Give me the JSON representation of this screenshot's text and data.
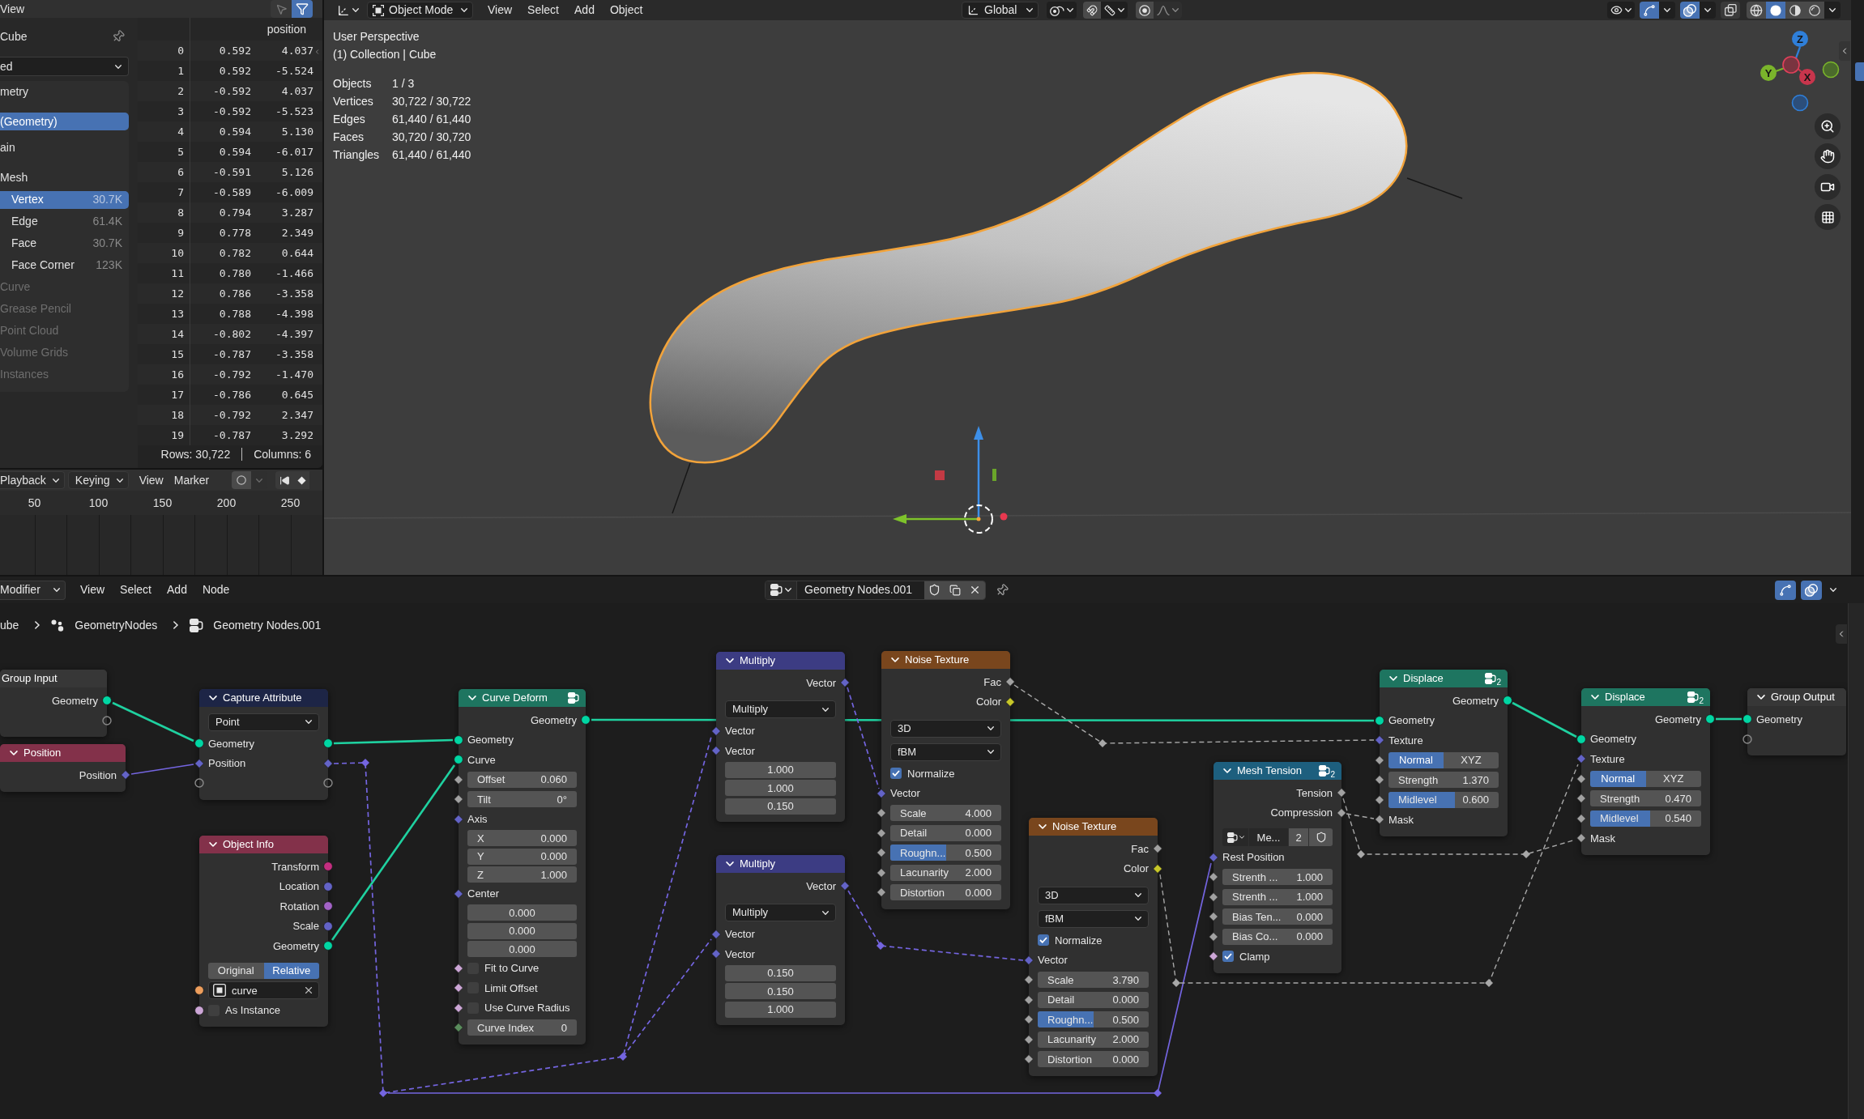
{
  "spreadsheet": {
    "header": {
      "menu": "View",
      "toggles": [
        {
          "kind": "selection",
          "on": false
        },
        {
          "kind": "filter",
          "on": true
        }
      ]
    },
    "sidebar": {
      "object": "Cube",
      "evaluation": "ed",
      "geometry_heading": "metry",
      "geometries": [
        {
          "label": "(Geometry)",
          "selected": true
        }
      ],
      "domain_heading": "ain",
      "domain_groups": [
        {
          "label": "Mesh",
          "disabled": false,
          "domains": [
            {
              "label": "Vertex",
              "count": "30.7K",
              "selected": true
            },
            {
              "label": "Edge",
              "count": "61.4K",
              "selected": false
            },
            {
              "label": "Face",
              "count": "30.7K",
              "selected": false
            },
            {
              "label": "Face Corner",
              "count": "123K",
              "selected": false
            }
          ]
        },
        {
          "label": "Curve",
          "disabled": true
        },
        {
          "label": "Grease Pencil",
          "disabled": true
        },
        {
          "label": "Point Cloud",
          "disabled": true
        },
        {
          "label": "Volume Grids",
          "disabled": true
        },
        {
          "label": "Instances",
          "disabled": true
        }
      ]
    },
    "table": {
      "column": "position",
      "rows": [
        {
          "index": "0",
          "values": [
            "0.592",
            "4.037"
          ]
        },
        {
          "index": "1",
          "values": [
            "0.592",
            "-5.524"
          ]
        },
        {
          "index": "2",
          "values": [
            "-0.592",
            "4.037"
          ]
        },
        {
          "index": "3",
          "values": [
            "-0.592",
            "-5.523"
          ]
        },
        {
          "index": "4",
          "values": [
            "0.594",
            "5.130"
          ]
        },
        {
          "index": "5",
          "values": [
            "0.594",
            "-6.017"
          ]
        },
        {
          "index": "6",
          "values": [
            "-0.591",
            "5.126"
          ]
        },
        {
          "index": "7",
          "values": [
            "-0.589",
            "-6.009"
          ]
        },
        {
          "index": "8",
          "values": [
            "0.794",
            "3.287"
          ]
        },
        {
          "index": "9",
          "values": [
            "0.778",
            "2.349"
          ]
        },
        {
          "index": "10",
          "values": [
            "0.782",
            "0.644"
          ]
        },
        {
          "index": "11",
          "values": [
            "0.780",
            "-1.466"
          ]
        },
        {
          "index": "12",
          "values": [
            "0.786",
            "-3.358"
          ]
        },
        {
          "index": "13",
          "values": [
            "0.788",
            "-4.398"
          ]
        },
        {
          "index": "14",
          "values": [
            "-0.802",
            "-4.397"
          ]
        },
        {
          "index": "15",
          "values": [
            "-0.787",
            "-3.358"
          ]
        },
        {
          "index": "16",
          "values": [
            "-0.792",
            "-1.470"
          ]
        },
        {
          "index": "17",
          "values": [
            "-0.786",
            "0.645"
          ]
        },
        {
          "index": "18",
          "values": [
            "-0.792",
            "2.347"
          ]
        },
        {
          "index": "19",
          "values": [
            "-0.787",
            "3.292"
          ]
        }
      ]
    },
    "footer": {
      "rows": "Rows: 30,722",
      "columns": "Columns: 6"
    }
  },
  "timeline": {
    "menus": [
      {
        "kind": "dropdown",
        "label": "Playback"
      },
      {
        "kind": "dropdown",
        "label": "Keying"
      },
      {
        "kind": "menu",
        "label": "View"
      },
      {
        "kind": "menu",
        "label": "Marker"
      }
    ],
    "auto_key": false,
    "frames": [
      "50",
      "100",
      "150",
      "200",
      "250"
    ]
  },
  "viewport": {
    "header": {
      "mode": "Object Mode",
      "menus": [
        "View",
        "Select",
        "Add",
        "Object"
      ],
      "orientation": "Global",
      "toggles": [
        {
          "kind": "gizmo",
          "on": true
        },
        {
          "kind": "overlay",
          "on": true
        },
        {
          "kind": "xray",
          "on": false
        }
      ],
      "shading": [
        {
          "kind": "wireframe",
          "selected": false
        },
        {
          "kind": "solid",
          "selected": true
        },
        {
          "kind": "material",
          "selected": false
        },
        {
          "kind": "rendered",
          "selected": false
        }
      ]
    },
    "overlay": {
      "view": "User Perspective",
      "context": "(1) Collection | Cube",
      "stats": [
        {
          "label": "Objects",
          "value": "1 / 3"
        },
        {
          "label": "Vertices",
          "value": "30,722 / 30,722"
        },
        {
          "label": "Edges",
          "value": "61,440 / 61,440"
        },
        {
          "label": "Faces",
          "value": "30,720 / 30,720"
        },
        {
          "label": "Triangles",
          "value": "61,440 / 61,440"
        }
      ]
    },
    "gizmo_axes": [
      {
        "label": "Z",
        "color": "#2f7fd9"
      },
      {
        "label": "Y",
        "color": "#7ab42b"
      },
      {
        "label": "X",
        "color": "#c8354c"
      }
    ]
  },
  "node_editor": {
    "header": {
      "editor": "Modifier",
      "menus": [
        "View",
        "Select",
        "Add",
        "Node"
      ],
      "tree": "Geometry Nodes.001",
      "toggles": [
        {
          "kind": "gizmo",
          "on": true
        },
        {
          "kind": "overlay",
          "on": true
        }
      ]
    },
    "breadcrumbs": [
      {
        "kind": "object",
        "label": "ube"
      },
      {
        "kind": "modifier",
        "label": "GeometryNodes"
      },
      {
        "kind": "node-tree",
        "label": "Geometry Nodes.001"
      }
    ],
    "nodes": [
      {
        "title": "Group Input",
        "color": "#373737",
        "group": false,
        "rows": [
          {
            "kind": "output",
            "label": "Geometry",
            "socket": {
              "kind": "circle",
              "color": "#00d6a3"
            }
          },
          {
            "kind": "output",
            "socket": {
              "kind": "ring"
            }
          }
        ]
      },
      {
        "title": "Position",
        "color": "#83314a",
        "expanded": true,
        "group": false,
        "rows": [
          {
            "kind": "output",
            "label": "Position",
            "socket": {
              "kind": "diamond",
              "color": "#6363c7"
            }
          }
        ]
      },
      {
        "title": "Capture Attribute",
        "color": "#1d2546",
        "expanded": true,
        "group": false,
        "rows": [
          {
            "kind": "dropdown",
            "value": "Point"
          },
          {
            "kind": "pass",
            "label": "Geometry",
            "socket": {
              "kind": "circle",
              "color": "#00d6a3"
            }
          },
          {
            "kind": "pass",
            "label": "Position",
            "socket": {
              "kind": "diamond",
              "color": "#6363c7"
            }
          },
          {
            "kind": "pass",
            "socket": {
              "kind": "ring"
            }
          }
        ]
      },
      {
        "title": "Object Info",
        "color": "#83314a",
        "expanded": true,
        "group": false,
        "rows": [
          {
            "kind": "output",
            "label": "Transform",
            "socket": {
              "kind": "circle",
              "color": "#c42e80"
            }
          },
          {
            "kind": "output",
            "label": "Location",
            "socket": {
              "kind": "circle",
              "color": "#6363c7"
            }
          },
          {
            "kind": "output",
            "label": "Rotation",
            "socket": {
              "kind": "circle",
              "color": "#a363c7"
            }
          },
          {
            "kind": "output",
            "label": "Scale",
            "socket": {
              "kind": "circle",
              "color": "#6363c7"
            }
          },
          {
            "kind": "output",
            "label": "Geometry",
            "socket": {
              "kind": "circle",
              "color": "#00d6a3"
            }
          },
          {
            "kind": "segmented",
            "options": [
              {
                "label": "Original",
                "selected": false
              },
              {
                "label": "Relative",
                "selected": true
              }
            ]
          },
          {
            "kind": "object",
            "value": "curve",
            "socket": {
              "kind": "circle",
              "color": "#ed9e5c"
            }
          },
          {
            "kind": "checkbox",
            "label": "As Instance",
            "checked": false,
            "socket": {
              "kind": "circle",
              "color": "#cca6d6"
            }
          }
        ]
      },
      {
        "title": "Curve Deform",
        "color": "#1e7560",
        "expanded": true,
        "group": true,
        "rows": [
          {
            "kind": "output",
            "label": "Geometry",
            "socket": {
              "kind": "circle",
              "color": "#00d6a3"
            }
          },
          {
            "kind": "input",
            "label": "Geometry",
            "socket": {
              "kind": "circle",
              "color": "#00d6a3"
            }
          },
          {
            "kind": "input",
            "label": "Curve",
            "socket": {
              "kind": "circle",
              "color": "#00d6a3"
            }
          },
          {
            "kind": "field",
            "label": "Offset",
            "value": "0.060",
            "socket": {
              "kind": "diamond",
              "color": "#a1a1a1"
            }
          },
          {
            "kind": "field",
            "label": "Tilt",
            "value": "0°",
            "socket": {
              "kind": "diamond",
              "color": "#a1a1a1"
            }
          },
          {
            "kind": "input",
            "label": "Axis",
            "socket": {
              "kind": "diamond",
              "color": "#6363c7"
            }
          },
          {
            "kind": "component",
            "label": "X",
            "value": "0.000"
          },
          {
            "kind": "component",
            "label": "Y",
            "value": "0.000"
          },
          {
            "kind": "component",
            "label": "Z",
            "value": "1.000"
          },
          {
            "kind": "input",
            "label": "Center",
            "socket": {
              "kind": "diamond",
              "color": "#6363c7"
            }
          },
          {
            "kind": "component",
            "value": "0.000"
          },
          {
            "kind": "component",
            "value": "0.000"
          },
          {
            "kind": "component",
            "value": "0.000"
          },
          {
            "kind": "checkbox",
            "label": "Fit to Curve",
            "checked": false,
            "socket": {
              "kind": "diamond",
              "color": "#cca6d6"
            }
          },
          {
            "kind": "checkbox",
            "label": "Limit Offset",
            "checked": false,
            "socket": {
              "kind": "diamond",
              "color": "#cca6d6"
            }
          },
          {
            "kind": "checkbox",
            "label": "Use Curve Radius",
            "checked": false,
            "socket": {
              "kind": "diamond",
              "color": "#cca6d6"
            }
          },
          {
            "kind": "field",
            "label": "Curve Index",
            "value": "0",
            "socket": {
              "kind": "diamond",
              "color": "#598c5c"
            }
          }
        ]
      },
      {
        "title": "Multiply",
        "color": "#3c3c83",
        "expanded": true,
        "group": false,
        "rows": [
          {
            "kind": "output",
            "label": "Vector",
            "socket": {
              "kind": "diamond",
              "color": "#6363c7"
            }
          },
          {
            "kind": "dropdown",
            "value": "Multiply"
          },
          {
            "kind": "input",
            "label": "Vector",
            "socket": {
              "kind": "diamond",
              "color": "#6363c7"
            }
          },
          {
            "kind": "input",
            "label": "Vector",
            "socket": {
              "kind": "diamond",
              "color": "#6363c7"
            }
          },
          {
            "kind": "component",
            "value": "1.000"
          },
          {
            "kind": "component",
            "value": "1.000"
          },
          {
            "kind": "component",
            "value": "0.150"
          }
        ]
      },
      {
        "title": "Multiply",
        "color": "#3c3c83",
        "expanded": true,
        "group": false,
        "rows": [
          {
            "kind": "output",
            "label": "Vector",
            "socket": {
              "kind": "diamond",
              "color": "#6363c7"
            }
          },
          {
            "kind": "dropdown",
            "value": "Multiply"
          },
          {
            "kind": "input",
            "label": "Vector",
            "socket": {
              "kind": "diamond",
              "color": "#6363c7"
            }
          },
          {
            "kind": "input",
            "label": "Vector",
            "socket": {
              "kind": "diamond",
              "color": "#6363c7"
            }
          },
          {
            "kind": "component",
            "value": "0.150"
          },
          {
            "kind": "component",
            "value": "0.150"
          },
          {
            "kind": "component",
            "value": "1.000"
          }
        ]
      },
      {
        "title": "Noise Texture",
        "color": "#79461d",
        "expanded": true,
        "group": false,
        "rows": [
          {
            "kind": "output",
            "label": "Fac",
            "socket": {
              "kind": "diamond",
              "color": "#a1a1a1"
            }
          },
          {
            "kind": "output",
            "label": "Color",
            "socket": {
              "kind": "diamond",
              "color": "#c7c729"
            }
          },
          {
            "kind": "dropdown",
            "value": "3D"
          },
          {
            "kind": "dropdown",
            "value": "fBM"
          },
          {
            "kind": "checkbox",
            "label": "Normalize",
            "checked": true
          },
          {
            "kind": "input",
            "label": "Vector",
            "socket": {
              "kind": "diamond",
              "color": "#6363c7"
            }
          },
          {
            "kind": "field",
            "label": "Scale",
            "value": "4.000",
            "socket": {
              "kind": "diamond",
              "color": "#a1a1a1"
            }
          },
          {
            "kind": "field",
            "label": "Detail",
            "value": "0.000",
            "socket": {
              "kind": "diamond",
              "color": "#a1a1a1"
            }
          },
          {
            "kind": "field",
            "label": "Roughn...",
            "value": "0.500",
            "level": 0.5,
            "socket": {
              "kind": "diamond",
              "color": "#a1a1a1"
            }
          },
          {
            "kind": "field",
            "label": "Lacunarity",
            "value": "2.000",
            "socket": {
              "kind": "diamond",
              "color": "#a1a1a1"
            }
          },
          {
            "kind": "field",
            "label": "Distortion",
            "value": "0.000",
            "socket": {
              "kind": "diamond",
              "color": "#a1a1a1"
            }
          }
        ]
      },
      {
        "title": "Noise Texture",
        "color": "#79461d",
        "expanded": true,
        "group": false,
        "rows": [
          {
            "kind": "output",
            "label": "Fac",
            "socket": {
              "kind": "diamond",
              "color": "#a1a1a1"
            }
          },
          {
            "kind": "output",
            "label": "Color",
            "socket": {
              "kind": "diamond",
              "color": "#c7c729"
            }
          },
          {
            "kind": "dropdown",
            "value": "3D"
          },
          {
            "kind": "dropdown",
            "value": "fBM"
          },
          {
            "kind": "checkbox",
            "label": "Normalize",
            "checked": true
          },
          {
            "kind": "input",
            "label": "Vector",
            "socket": {
              "kind": "diamond",
              "color": "#6363c7"
            }
          },
          {
            "kind": "field",
            "label": "Scale",
            "value": "3.790",
            "socket": {
              "kind": "diamond",
              "color": "#a1a1a1"
            }
          },
          {
            "kind": "field",
            "label": "Detail",
            "value": "0.000",
            "socket": {
              "kind": "diamond",
              "color": "#a1a1a1"
            }
          },
          {
            "kind": "field",
            "label": "Roughn...",
            "value": "0.500",
            "level": 0.5,
            "socket": {
              "kind": "diamond",
              "color": "#a1a1a1"
            }
          },
          {
            "kind": "field",
            "label": "Lacunarity",
            "value": "2.000",
            "socket": {
              "kind": "diamond",
              "color": "#a1a1a1"
            }
          },
          {
            "kind": "field",
            "label": "Distortion",
            "value": "0.000",
            "socket": {
              "kind": "diamond",
              "color": "#a1a1a1"
            }
          }
        ]
      },
      {
        "title": "Mesh Tension",
        "color": "#1d5f7e",
        "expanded": true,
        "group": true,
        "users": "2",
        "rows": [
          {
            "kind": "output",
            "label": "Tension",
            "socket": {
              "kind": "diamond",
              "color": "#a1a1a1"
            }
          },
          {
            "kind": "output",
            "label": "Compression",
            "socket": {
              "kind": "diamond",
              "color": "#a1a1a1"
            }
          },
          {
            "kind": "users",
            "value": "Me...",
            "users": "2"
          },
          {
            "kind": "input",
            "label": "Rest Position",
            "socket": {
              "kind": "diamond",
              "color": "#6363c7"
            }
          },
          {
            "kind": "field",
            "label": "Strenth ...",
            "value": "1.000",
            "socket": {
              "kind": "diamond",
              "color": "#a1a1a1"
            }
          },
          {
            "kind": "field",
            "label": "Strenth ...",
            "value": "1.000",
            "socket": {
              "kind": "diamond",
              "color": "#a1a1a1"
            }
          },
          {
            "kind": "field",
            "label": "Bias Ten...",
            "value": "0.000",
            "socket": {
              "kind": "diamond",
              "color": "#a1a1a1"
            }
          },
          {
            "kind": "field",
            "label": "Bias Co...",
            "value": "0.000",
            "socket": {
              "kind": "diamond",
              "color": "#a1a1a1"
            }
          },
          {
            "kind": "checkbox",
            "label": "Clamp",
            "checked": true,
            "socket": {
              "kind": "diamond",
              "color": "#cca6d6"
            }
          }
        ]
      },
      {
        "title": "Displace",
        "color": "#1e7560",
        "expanded": true,
        "group": true,
        "users": "2",
        "rows": [
          {
            "kind": "output",
            "label": "Geometry",
            "socket": {
              "kind": "circle",
              "color": "#00d6a3"
            }
          },
          {
            "kind": "input",
            "label": "Geometry",
            "socket": {
              "kind": "circle",
              "color": "#00d6a3"
            }
          },
          {
            "kind": "input",
            "label": "Texture",
            "socket": {
              "kind": "diamond",
              "color": "#6363c7"
            }
          },
          {
            "kind": "segmented",
            "socket": {
              "kind": "diamond",
              "color": "#a1a1a1"
            },
            "options": [
              {
                "label": "Normal",
                "selected": true
              },
              {
                "label": "XYZ",
                "selected": false
              }
            ]
          },
          {
            "kind": "field",
            "label": "Strength",
            "value": "1.370",
            "socket": {
              "kind": "diamond",
              "color": "#a1a1a1"
            }
          },
          {
            "kind": "field",
            "label": "Midlevel",
            "value": "0.600",
            "level": 0.6,
            "socket": {
              "kind": "diamond",
              "color": "#a1a1a1"
            }
          },
          {
            "kind": "input",
            "label": "Mask",
            "socket": {
              "kind": "diamond",
              "color": "#a1a1a1"
            }
          }
        ]
      },
      {
        "title": "Displace",
        "color": "#1e7560",
        "expanded": true,
        "group": true,
        "users": "2",
        "rows": [
          {
            "kind": "output",
            "label": "Geometry",
            "socket": {
              "kind": "circle",
              "color": "#00d6a3"
            }
          },
          {
            "kind": "input",
            "label": "Geometry",
            "socket": {
              "kind": "circle",
              "color": "#00d6a3"
            }
          },
          {
            "kind": "input",
            "label": "Texture",
            "socket": {
              "kind": "diamond",
              "color": "#6363c7"
            }
          },
          {
            "kind": "segmented",
            "socket": {
              "kind": "diamond",
              "color": "#a1a1a1"
            },
            "options": [
              {
                "label": "Normal",
                "selected": true
              },
              {
                "label": "XYZ",
                "selected": false
              }
            ]
          },
          {
            "kind": "field",
            "label": "Strength",
            "value": "0.470",
            "socket": {
              "kind": "diamond",
              "color": "#a1a1a1"
            }
          },
          {
            "kind": "field",
            "label": "Midlevel",
            "value": "0.540",
            "level": 0.54,
            "socket": {
              "kind": "diamond",
              "color": "#a1a1a1"
            }
          },
          {
            "kind": "input",
            "label": "Mask",
            "socket": {
              "kind": "diamond",
              "color": "#a1a1a1"
            }
          }
        ]
      },
      {
        "title": "Group Output",
        "color": "#373737",
        "expanded": true,
        "group": false,
        "rows": [
          {
            "kind": "input",
            "label": "Geometry",
            "socket": {
              "kind": "circle",
              "color": "#00d6a3"
            }
          },
          {
            "kind": "input",
            "socket": {
              "kind": "ring"
            }
          }
        ]
      }
    ]
  }
}
